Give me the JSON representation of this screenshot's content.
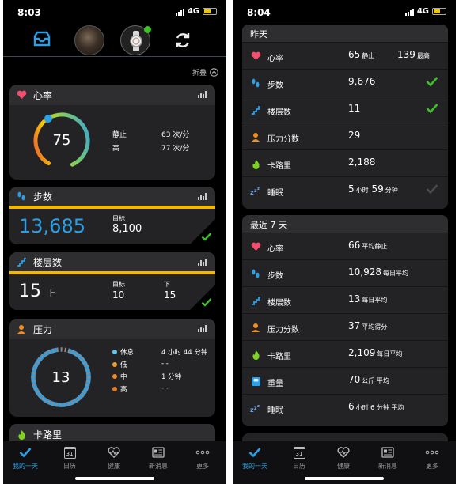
{
  "left": {
    "status": {
      "time": "8:03",
      "network": "4G"
    },
    "collapse_label": "折叠",
    "heart": {
      "title": "心率",
      "value": "75",
      "rows": [
        {
          "label": "静止",
          "value": "63 次/分"
        },
        {
          "label": "高",
          "value": "77 次/分"
        }
      ]
    },
    "steps": {
      "title": "步数",
      "value": "13,685",
      "goal_label": "目标",
      "goal_value": "8,100"
    },
    "floors": {
      "title": "楼层数",
      "value": "15",
      "unit": "上",
      "goal_label": "目标",
      "goal_value": "10",
      "down_label": "下",
      "down_value": "15"
    },
    "stress": {
      "title": "压力",
      "value": "13",
      "items": [
        {
          "label": "休息",
          "value": "4 小时 44 分钟",
          "color": "#5fc8f0"
        },
        {
          "label": "低",
          "value": "- -",
          "color": "#f0a030"
        },
        {
          "label": "中",
          "value": "1 分钟",
          "color": "#f08c20"
        },
        {
          "label": "高",
          "value": "- -",
          "color": "#e57a1a"
        }
      ]
    },
    "calories": {
      "title": "卡路里"
    }
  },
  "right": {
    "status": {
      "time": "8:04",
      "network": "4G"
    },
    "yesterday": {
      "title": "昨天",
      "rows": [
        {
          "icon": "heart-icon",
          "label": "心率",
          "value": "65",
          "value_unit": "静止",
          "value2": "139",
          "value2_unit": "最高",
          "check": ""
        },
        {
          "icon": "footprints-icon",
          "label": "步数",
          "value": "9,676",
          "value_unit": "",
          "value2": "",
          "value2_unit": "",
          "check": "green"
        },
        {
          "icon": "stairs-icon",
          "label": "楼层数",
          "value": "11",
          "value_unit": "",
          "value2": "",
          "value2_unit": "",
          "check": "green"
        },
        {
          "icon": "stress-person-icon",
          "label": "压力分数",
          "value": "29",
          "value_unit": "",
          "value2": "",
          "value2_unit": "",
          "check": ""
        },
        {
          "icon": "flame-icon",
          "label": "卡路里",
          "value": "2,188",
          "value_unit": "",
          "value2": "",
          "value2_unit": "",
          "check": ""
        },
        {
          "icon": "sleep-icon",
          "label": "睡眠",
          "value": "5",
          "value_unit": "小时",
          "value2": "59",
          "value2_unit": "分钟",
          "check": "gray"
        }
      ]
    },
    "week": {
      "title": "最近 7 天",
      "rows": [
        {
          "icon": "heart-icon",
          "label": "心率",
          "value": "66",
          "value_unit": "平均静止"
        },
        {
          "icon": "footprints-icon",
          "label": "步数",
          "value": "10,928",
          "value_unit": "每日平均"
        },
        {
          "icon": "stairs-icon",
          "label": "楼层数",
          "value": "13",
          "value_unit": "每日平均"
        },
        {
          "icon": "stress-person-icon",
          "label": "压力分数",
          "value": "37",
          "value_unit": "平均得分"
        },
        {
          "icon": "flame-icon",
          "label": "卡路里",
          "value": "2,109",
          "value_unit": "每日平均"
        },
        {
          "icon": "scale-icon",
          "label": "重量",
          "value": "70",
          "value_unit": "公斤 平均"
        },
        {
          "icon": "sleep-icon",
          "label": "睡眠",
          "value": "6",
          "value_unit": "小时 6 分钟 平均"
        }
      ]
    }
  },
  "nav": [
    {
      "label": "我的一天"
    },
    {
      "label": "日历"
    },
    {
      "label": "健康"
    },
    {
      "label": "新消息"
    },
    {
      "label": "更多"
    }
  ],
  "calendar_day": "31",
  "colors": {
    "accent": "#2aa0e8",
    "yellow": "#f5b800",
    "green": "#3fbf2a"
  }
}
